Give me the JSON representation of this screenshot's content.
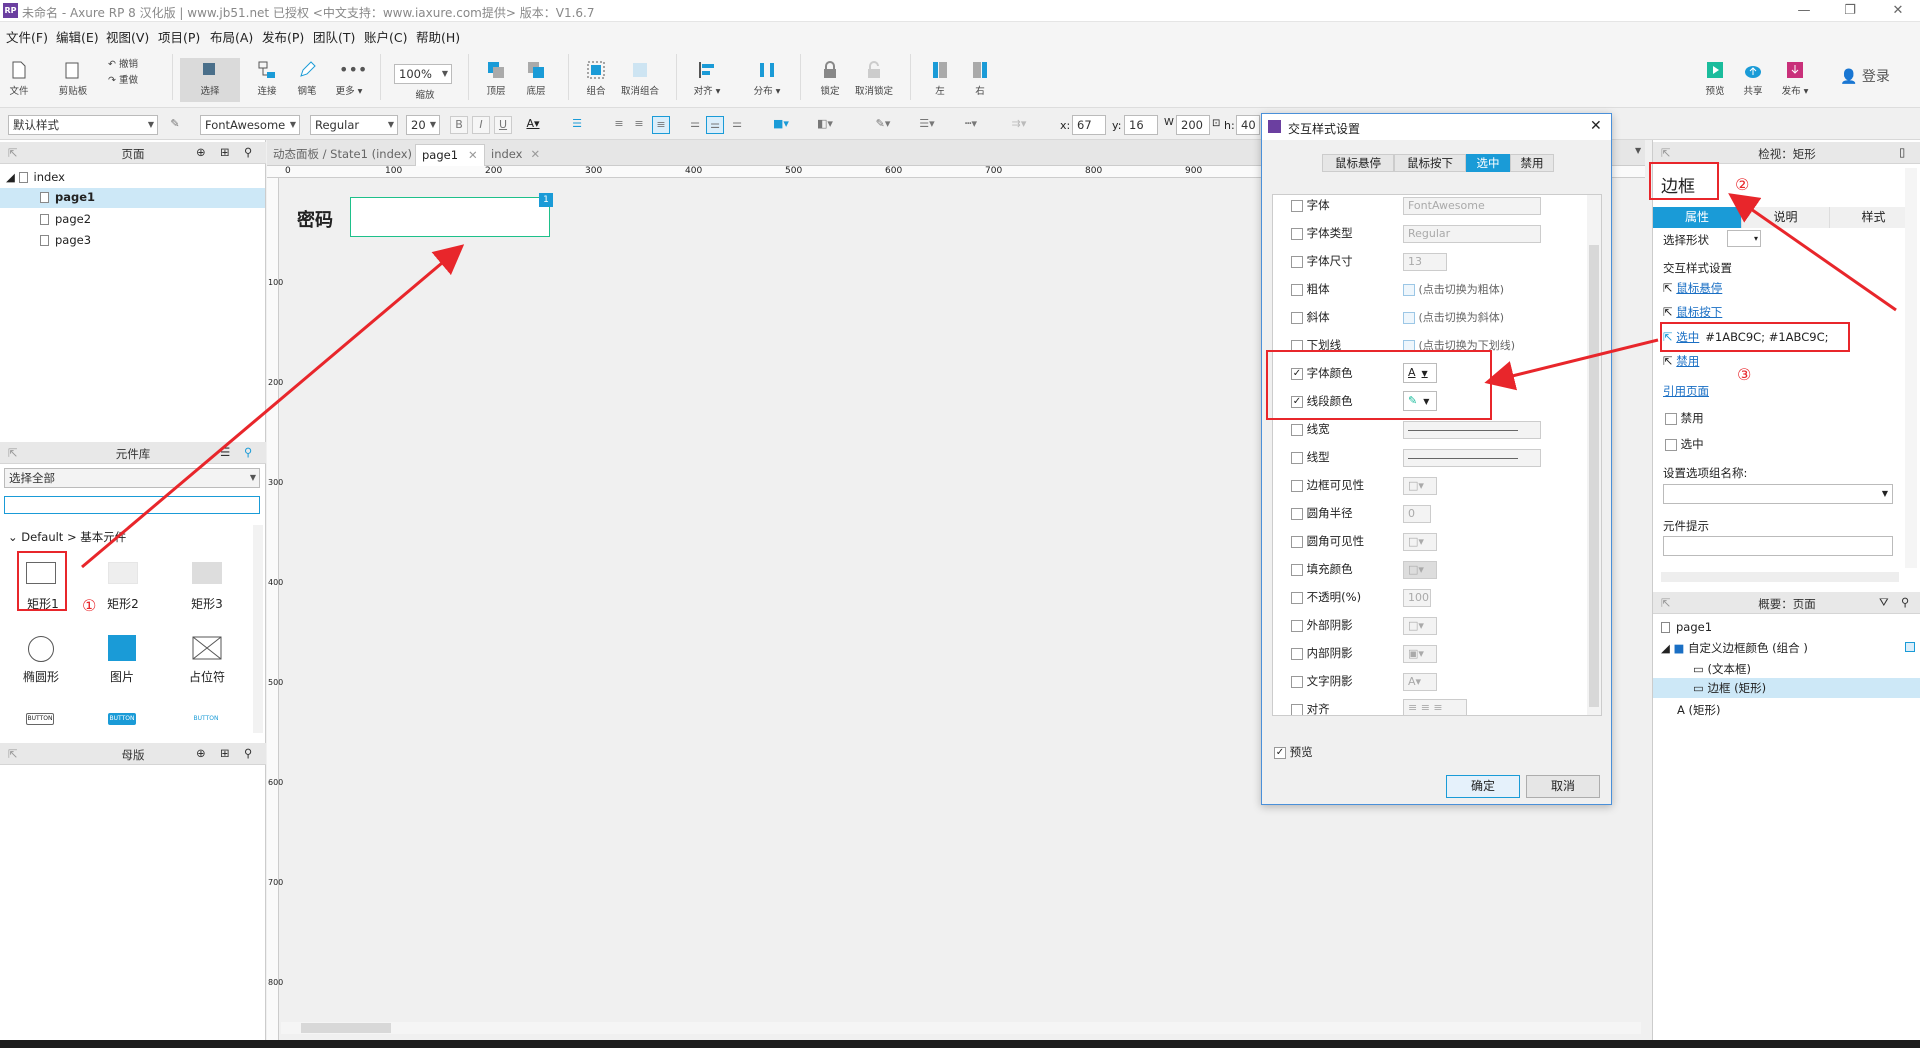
{
  "titlebar": {
    "logo": "RP",
    "title": "未命名 - Axure RP 8 汉化版 | www.jb51.net 已授权    <中文支持：www.iaxure.com提供> 版本：V1.6.7",
    "minimize": "—",
    "maximize": "❐",
    "close": "✕"
  },
  "menu": [
    "文件(F)",
    "编辑(E)",
    "视图(V)",
    "项目(P)",
    "布局(A)",
    "发布(P)",
    "团队(T)",
    "账户(C)",
    "帮助(H)"
  ],
  "toolbar": {
    "file": "文件",
    "clipboard": "剪贴板",
    "undo": "撤销",
    "redo": "重做",
    "select": "选择",
    "connect": "连接",
    "pen": "钢笔",
    "more": "更多 ▾",
    "zoom_value": "100%",
    "zoom_label": "缩放",
    "top": "顶层",
    "bottom": "底层",
    "group": "组合",
    "ungroup": "取消组合",
    "align": "对齐 ▾",
    "distribute": "分布 ▾",
    "lock": "锁定",
    "unlock": "取消锁定",
    "left": "左",
    "right": "右",
    "preview": "预览",
    "share": "共享",
    "publish": "发布 ▾",
    "login": "登录"
  },
  "format": {
    "style": "默认样式",
    "font": "FontAwesome",
    "weight": "Regular",
    "size": "20",
    "bold": "B",
    "italic": "I",
    "underline": "U",
    "x_label": "x:",
    "x": "67",
    "y_label": "y:",
    "y": "16",
    "w_label": "W",
    "w": "200",
    "h_label": "h:",
    "h": "40"
  },
  "pages_panel": {
    "title": "页面",
    "items": [
      "index",
      "page1",
      "page2",
      "page3"
    ]
  },
  "library_panel": {
    "title": "元件库",
    "filter": "选择全部",
    "section": "Default > 基本元件",
    "widgets": [
      "矩形1",
      "矩形2",
      "矩形3",
      "椭圆形",
      "图片",
      "占位符"
    ],
    "buttons": [
      "BUTTON",
      "BUTTON",
      "BUTTON"
    ]
  },
  "masters_panel": {
    "title": "母版"
  },
  "tabs": [
    "动态面板 / State1 (index)",
    "page1",
    "index"
  ],
  "ruler": [
    "0",
    "100",
    "200",
    "300",
    "400",
    "500",
    "600",
    "700",
    "800",
    "900"
  ],
  "vruler": [
    "100",
    "200",
    "300",
    "400",
    "500",
    "600",
    "700",
    "800"
  ],
  "canvas": {
    "label": "密码",
    "badge": "1"
  },
  "dialog": {
    "title": "交互样式设置",
    "tabs": [
      "鼠标悬停",
      "鼠标按下",
      "选中",
      "禁用"
    ],
    "active_tab": "选中",
    "rows": [
      {
        "label": "字体",
        "checked": false,
        "value": "FontAwesome"
      },
      {
        "label": "字体类型",
        "checked": false,
        "value": "Regular"
      },
      {
        "label": "字体尺寸",
        "checked": false,
        "value": "13"
      },
      {
        "label": "粗体",
        "checked": false,
        "value": "(点击切换为粗体)"
      },
      {
        "label": "斜体",
        "checked": false,
        "value": "(点击切换为斜体)"
      },
      {
        "label": "下划线",
        "checked": false,
        "value": "(点击切换为下划线)"
      },
      {
        "label": "字体颜色",
        "checked": true,
        "value": "A"
      },
      {
        "label": "线段颜色",
        "checked": true,
        "value": ""
      },
      {
        "label": "线宽",
        "checked": false,
        "value": ""
      },
      {
        "label": "线型",
        "checked": false,
        "value": ""
      },
      {
        "label": "边框可见性",
        "checked": false,
        "value": ""
      },
      {
        "label": "圆角半径",
        "checked": false,
        "value": "0"
      },
      {
        "label": "圆角可见性",
        "checked": false,
        "value": ""
      },
      {
        "label": "填充颜色",
        "checked": false,
        "value": ""
      },
      {
        "label": "不透明(%)",
        "checked": false,
        "value": "100"
      },
      {
        "label": "外部阴影",
        "checked": false,
        "value": ""
      },
      {
        "label": "内部阴影",
        "checked": false,
        "value": ""
      },
      {
        "label": "文字阴影",
        "checked": false,
        "value": "A"
      },
      {
        "label": "对齐",
        "checked": false,
        "value": ""
      }
    ],
    "preview": "预览",
    "ok": "确定",
    "cancel": "取消"
  },
  "inspector": {
    "header": "检视：矩形",
    "name": "边框",
    "tabs": [
      "属性",
      "说明",
      "样式"
    ],
    "select_shape": "选择形状",
    "interaction_title": "交互样式设置",
    "hover": "鼠标悬停",
    "mousedown": "鼠标按下",
    "selected": "选中",
    "selected_value": "#1ABC9C; #1ABC9C;",
    "disabled": "禁用",
    "ref_page": "引用页面",
    "cb_disabled": "禁用",
    "cb_selected": "选中",
    "group_name_label": "设置选项组名称:",
    "tooltip_label": "元件提示"
  },
  "outline": {
    "title": "概要：页面",
    "items": [
      "page1",
      "自定义边框颜色 (组合 )",
      "(文本框)",
      "边框 (矩形)",
      "(矩形)"
    ]
  },
  "annotations": [
    "①",
    "②",
    "③"
  ],
  "colors": {
    "accent": "#1a9bd7",
    "red": "#e8262b",
    "selection": "#cde8f7"
  }
}
